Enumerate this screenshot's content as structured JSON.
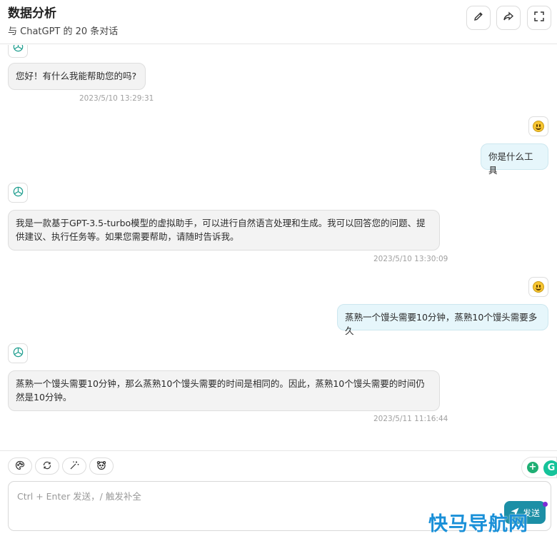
{
  "header": {
    "title": "数据分析",
    "subtitle": "与 ChatGPT 的 20 条对话",
    "buttons": [
      "edit-icon",
      "share-icon",
      "fullscreen-icon"
    ]
  },
  "messages": [
    {
      "role": "assistant",
      "text": "您好！有什么我能帮助您的吗?",
      "time": "2023/5/10 13:29:31"
    },
    {
      "role": "user",
      "text": "你是什么工具"
    },
    {
      "role": "assistant",
      "text": "我是一款基于GPT-3.5-turbo模型的虚拟助手，可以进行自然语言处理和生成。我可以回答您的问题、提供建议、执行任务等。如果您需要帮助，请随时告诉我。",
      "time": "2023/5/10 13:30:09"
    },
    {
      "role": "user",
      "text": "蒸熟一个馒头需要10分钟，蒸熟10个馒头需要多久"
    },
    {
      "role": "assistant",
      "text": "蒸熟一个馒头需要10分钟，那么蒸熟10个馒头需要的时间是相同的。因此，蒸熟10个馒头需要的时间仍然是10分钟。",
      "time": "2023/5/11 11:16:44"
    }
  ],
  "composer": {
    "tools": [
      "palette-icon",
      "refresh-icon",
      "magic-wand-icon",
      "mask-icon"
    ],
    "placeholder": "Ctrl + Enter 发送，/ 触发补全",
    "send_label": "发送"
  },
  "watermark": "快马导航网",
  "colors": {
    "accent": "#1c8fa6",
    "user_bubble": "#e6f6fb",
    "bot_bubble": "#f3f3f3"
  }
}
